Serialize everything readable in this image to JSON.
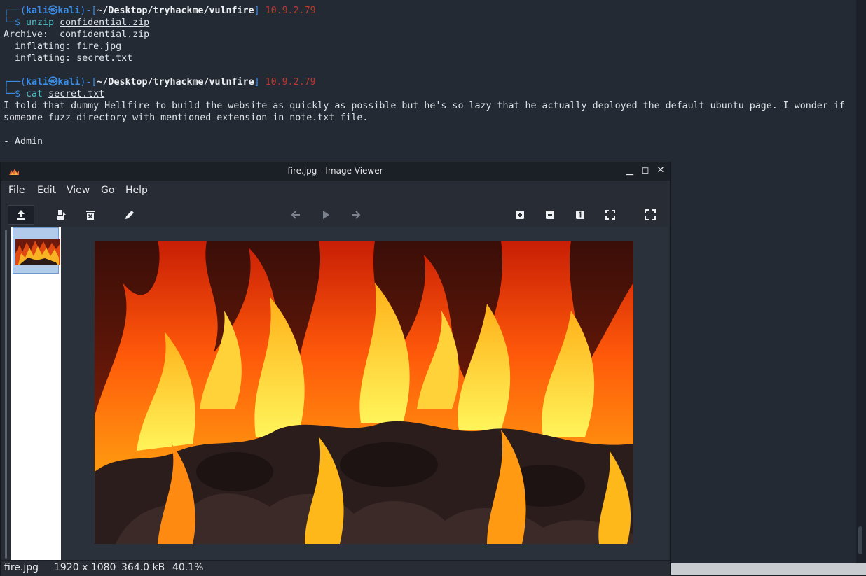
{
  "terminal": {
    "block1": {
      "user": "kali",
      "host": "kali",
      "path": "~/Desktop/tryhackme/vulnfire",
      "ip": "10.9.2.79",
      "cmd": "unzip",
      "arg": "confidential.zip",
      "output": [
        "Archive:  confidential.zip",
        "  inflating: fire.jpg",
        "  inflating: secret.txt"
      ]
    },
    "block2": {
      "user": "kali",
      "host": "kali",
      "path": "~/Desktop/tryhackme/vulnfire",
      "ip": "10.9.2.79",
      "cmd": "cat",
      "arg": "secret.txt",
      "output": [
        "I told that dummy Hellfire to build the website as quickly as possible but he's so lazy that he actually deployed the default ubuntu page. I wonder if",
        "someone fuzz directory with mentioned extension in note.txt file.",
        "",
        "- Admin"
      ]
    }
  },
  "viewer": {
    "title": "fire.jpg - Image Viewer",
    "menu": [
      "File",
      "Edit",
      "View",
      "Go",
      "Help"
    ],
    "toolbar": {
      "left": [
        "upload-icon",
        "save-icon",
        "delete-icon",
        "edit-icon"
      ],
      "center": [
        "arrow-left-icon",
        "play-icon",
        "arrow-right-icon"
      ],
      "right": [
        "zoom-in-icon",
        "zoom-out-icon",
        "zoom-1-icon",
        "fit-icon",
        "fullscreen-icon"
      ]
    },
    "status": {
      "filename": "fire.jpg",
      "dimensions": "1920 x 1080",
      "filesize": "364.0 kB",
      "zoom": "40.1%"
    },
    "colors": {
      "accent_blue": "#3b8ee8",
      "ip_red": "#c0392b",
      "thumb_selection": "#b3cbeb"
    }
  }
}
